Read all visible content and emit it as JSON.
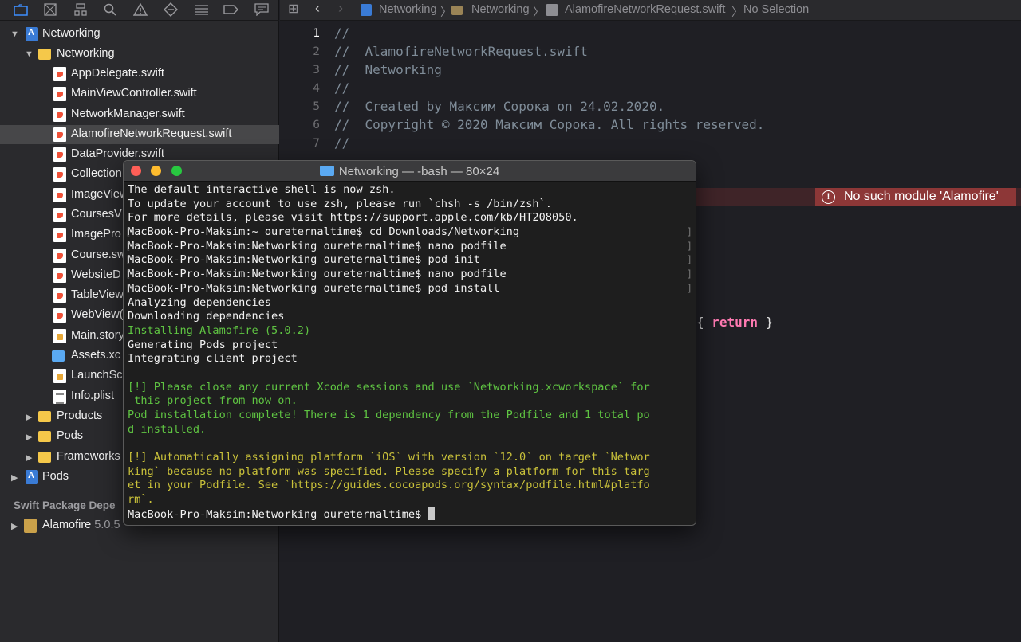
{
  "navigator": {
    "toolbar_icons": [
      "folder-icon",
      "source-control-icon",
      "hierarchy-icon",
      "search-icon",
      "issue-warning-icon",
      "test-diamond-icon",
      "debug-list-icon",
      "breakpoint-icon",
      "report-bubble-icon"
    ],
    "tree": {
      "project": "Networking",
      "group": "Networking",
      "files": [
        "AppDelegate.swift",
        "MainViewController.swift",
        "NetworkManager.swift",
        "AlamofireNetworkRequest.swift",
        "DataProvider.swift",
        "Collection",
        "ImageView",
        "CoursesV",
        "ImagePro",
        "Course.sw",
        "WebsiteD",
        "TableView",
        "WebView(",
        "Main.story",
        "Assets.xc",
        "LaunchSc",
        "Info.plist"
      ],
      "selected_file": "AlamofireNetworkRequest.swift",
      "groups_after": [
        "Products",
        "Pods",
        "Frameworks"
      ],
      "pods_project": "Pods"
    },
    "section_header": "Swift Package Depe",
    "package": {
      "name": "Alamofire",
      "version": "5.0.5"
    }
  },
  "jumpbar": {
    "crumbs": [
      "Networking",
      "Networking",
      "AlamofireNetworkRequest.swift",
      "No Selection"
    ]
  },
  "editor": {
    "line_numbers": [
      "1",
      "2",
      "3",
      "4",
      "5",
      "6",
      "7"
    ],
    "lines": [
      "//",
      "//  AlamofireNetworkRequest.swift",
      "//  Networking",
      "//",
      "//  Created by Максим Сорока on 24.02.2020.",
      "//  Copyright © 2020 Максим Сорока. All rights reserved.",
      "//"
    ],
    "error_message": "No such module 'Alamofire'",
    "return_code_prefix": "{ ",
    "return_keyword": "return",
    "return_code_suffix": " }"
  },
  "terminal": {
    "title": "Networking — -bash — 80×24",
    "lines": [
      {
        "text": "The default interactive shell is now zsh.",
        "color": "white"
      },
      {
        "text": "To update your account to use zsh, please run `chsh -s /bin/zsh`.",
        "color": "white"
      },
      {
        "text": "For more details, please visit https://support.apple.com/kb/HT208050.",
        "color": "white"
      },
      {
        "text": "MacBook-Pro-Maksim:~ oureternaltime$ cd Downloads/Networking",
        "color": "white"
      },
      {
        "text": "MacBook-Pro-Maksim:Networking oureternaltime$ nano podfile",
        "color": "white"
      },
      {
        "text": "MacBook-Pro-Maksim:Networking oureternaltime$ pod init",
        "color": "white"
      },
      {
        "text": "MacBook-Pro-Maksim:Networking oureternaltime$ nano podfile",
        "color": "white"
      },
      {
        "text": "MacBook-Pro-Maksim:Networking oureternaltime$ pod install",
        "color": "white"
      },
      {
        "text": "Analyzing dependencies",
        "color": "white"
      },
      {
        "text": "Downloading dependencies",
        "color": "white"
      },
      {
        "text": "Installing Alamofire (5.0.2)",
        "color": "green"
      },
      {
        "text": "Generating Pods project",
        "color": "white"
      },
      {
        "text": "Integrating client project",
        "color": "white"
      },
      {
        "text": "",
        "color": "white"
      },
      {
        "text": "[!] Please close any current Xcode sessions and use `Networking.xcworkspace` for",
        "color": "green"
      },
      {
        "text": " this project from now on.",
        "color": "green"
      },
      {
        "text": "Pod installation complete! There is 1 dependency from the Podfile and 1 total po",
        "color": "green"
      },
      {
        "text": "d installed.",
        "color": "green"
      },
      {
        "text": "",
        "color": "white"
      },
      {
        "text": "[!] Automatically assigning platform `iOS` with version `12.0` on target `Networ",
        "color": "yellow"
      },
      {
        "text": "king` because no platform was specified. Please specify a platform for this targ",
        "color": "yellow"
      },
      {
        "text": "et in your Podfile. See `https://guides.cocoapods.org/syntax/podfile.html#platfo",
        "color": "yellow"
      },
      {
        "text": "rm`.",
        "color": "yellow"
      }
    ],
    "prompt": "MacBook-Pro-Maksim:Networking oureternaltime$ "
  },
  "colors": {
    "accent": "#3d8eff",
    "error_badge": "#8d3737",
    "terminal_green": "#5fc442",
    "terminal_yellow": "#c9c13a",
    "swift_keyword": "#ff7ab2"
  }
}
